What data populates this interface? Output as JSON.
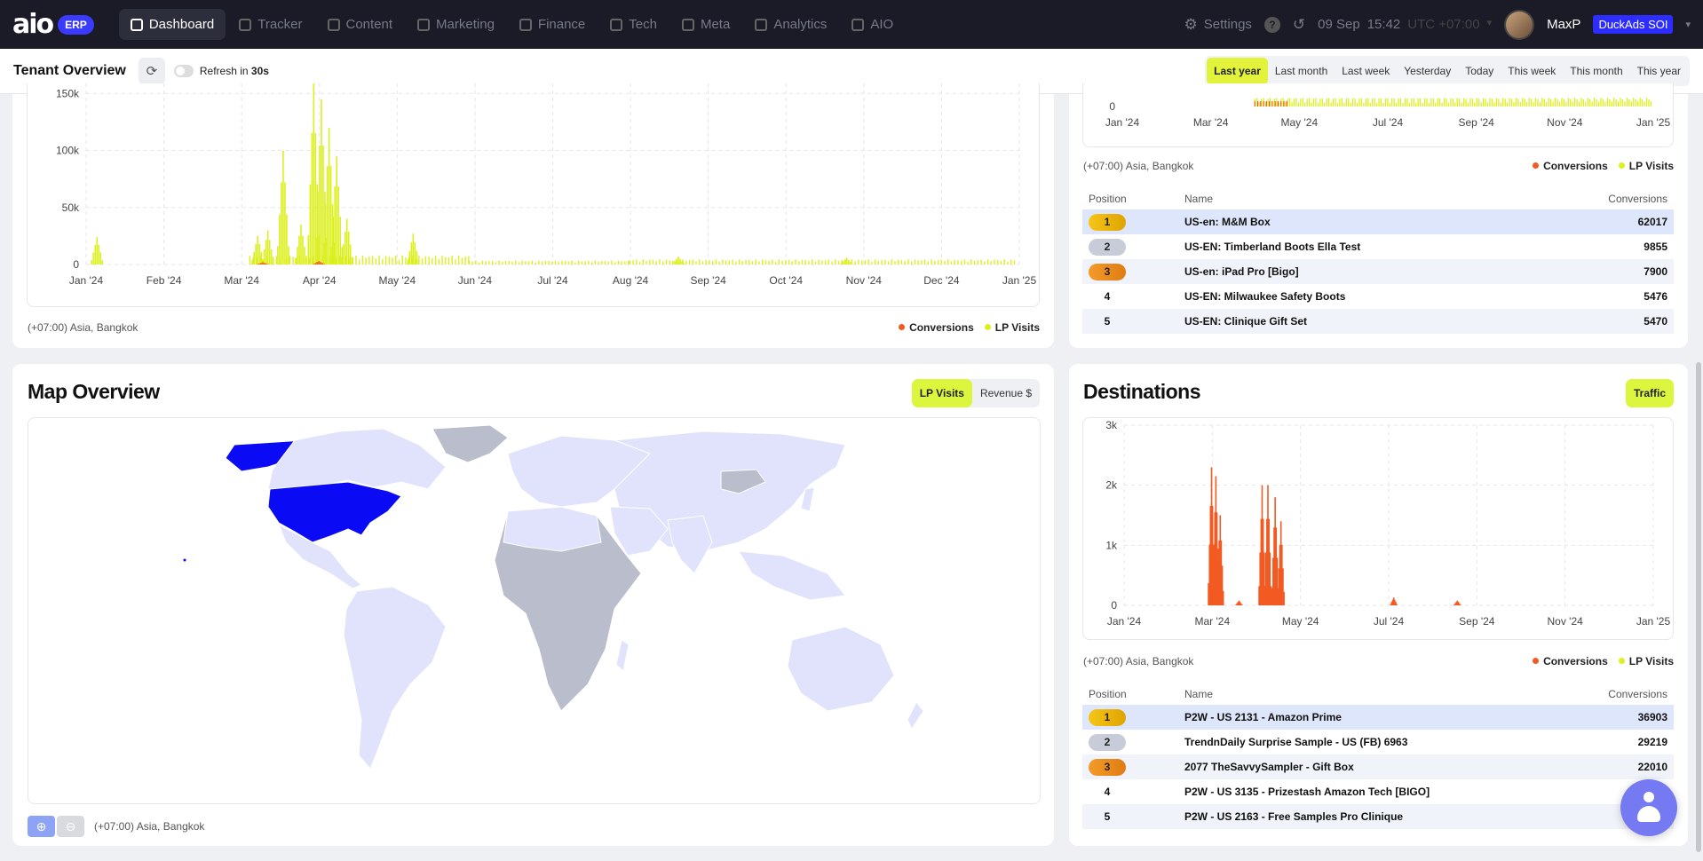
{
  "nav": {
    "logo": "aio",
    "logo_badge": "ERP",
    "items": [
      {
        "label": "Dashboard",
        "icon": "dashboard-icon",
        "active": true
      },
      {
        "label": "Tracker",
        "icon": "tracker-icon"
      },
      {
        "label": "Content",
        "icon": "content-icon"
      },
      {
        "label": "Marketing",
        "icon": "marketing-icon"
      },
      {
        "label": "Finance",
        "icon": "finance-icon"
      },
      {
        "label": "Tech",
        "icon": "tech-icon"
      },
      {
        "label": "Meta",
        "icon": "meta-icon"
      },
      {
        "label": "Analytics",
        "icon": "analytics-icon"
      },
      {
        "label": "AIO",
        "icon": "aio-icon"
      }
    ],
    "settings_label": "Settings",
    "date": "09 Sep",
    "time": "15:42",
    "timezone": "UTC +07:00",
    "user_name": "MaxP",
    "brand": "DuckAds SOI"
  },
  "header": {
    "title": "Tenant Overview",
    "refresh_prefix": "Refresh in",
    "refresh_value": "30s",
    "ranges": [
      "Last year",
      "Last month",
      "Last week",
      "Yesterday",
      "Today",
      "This week",
      "This month",
      "This year"
    ],
    "active_range": "Last year"
  },
  "legend": {
    "conversions": "Conversions",
    "lp_visits": "LP Visits"
  },
  "colors": {
    "conversions": "#f25a23",
    "lp_visits": "#dcef1f",
    "accent": "#dcf63e",
    "highlight": "#0000ff"
  },
  "timezone_label": "(+07:00)  Asia, Bangkok",
  "main_chart": {
    "chart_data": {
      "type": "bar",
      "x_ticks": [
        "Jan '24",
        "Feb '24",
        "Mar '24",
        "Apr '24",
        "May '24",
        "Jun '24",
        "Jul '24",
        "Aug '24",
        "Sep '24",
        "Oct '24",
        "Nov '24",
        "Dec '24",
        "Jan '25"
      ],
      "y_ticks": [
        "0",
        "50k",
        "100k",
        "150k"
      ],
      "ylim": [
        0,
        165000
      ],
      "grid": true,
      "series": [
        {
          "name": "LP Visits",
          "color": "#dcef1f",
          "peaks": [
            {
              "date": "2024-01-05",
              "value": 24000
            },
            {
              "date": "2024-03-08",
              "value": 25000
            },
            {
              "date": "2024-03-12",
              "value": 30000
            },
            {
              "date": "2024-03-18",
              "value": 100000
            },
            {
              "date": "2024-03-25",
              "value": 35000
            },
            {
              "date": "2024-03-30",
              "value": 160000
            },
            {
              "date": "2024-04-02",
              "value": 145000
            },
            {
              "date": "2024-04-05",
              "value": 120000
            },
            {
              "date": "2024-04-08",
              "value": 95000
            },
            {
              "date": "2024-04-12",
              "value": 40000
            },
            {
              "date": "2024-05-08",
              "value": 27000
            },
            {
              "date": "2024-08-20",
              "value": 7000
            },
            {
              "date": "2024-10-25",
              "value": 6000
            }
          ]
        },
        {
          "name": "Conversions",
          "color": "#f25a23",
          "peaks": [
            {
              "date": "2024-03-10",
              "value": 2000
            },
            {
              "date": "2024-04-01",
              "value": 3000
            }
          ]
        }
      ]
    }
  },
  "offers": {
    "chart_data": {
      "type": "bar",
      "x_ticks": [
        "Jan '24",
        "Mar '24",
        "May '24",
        "Jul '24",
        "Sep '24",
        "Nov '24",
        "Jan '25"
      ],
      "y_ticks": [
        "0"
      ]
    },
    "columns": [
      "Position",
      "Name",
      "Conversions"
    ],
    "rows": [
      {
        "pos": "1",
        "name": "US-en: M&M Box",
        "conv": "62017"
      },
      {
        "pos": "2",
        "name": "US-EN: Timberland Boots Ella Test",
        "conv": "9855"
      },
      {
        "pos": "3",
        "name": "US-en: iPad Pro [Bigo]",
        "conv": "7900"
      },
      {
        "pos": "4",
        "name": "US-EN: Milwaukee Safety Boots",
        "conv": "5476"
      },
      {
        "pos": "5",
        "name": "US-EN: Clinique Gift Set",
        "conv": "5470"
      }
    ]
  },
  "map": {
    "title": "Map Overview",
    "tabs": [
      "LP Visits",
      "Revenue $"
    ],
    "active_tab": "LP Visits"
  },
  "destinations": {
    "title": "Destinations",
    "tab": "Traffic",
    "chart_data": {
      "type": "bar",
      "x_ticks": [
        "Jan '24",
        "Mar '24",
        "May '24",
        "Jul '24",
        "Sep '24",
        "Nov '24",
        "Jan '25"
      ],
      "y_ticks": [
        "0",
        "1k",
        "2k",
        "3k"
      ],
      "ylim": [
        0,
        3000
      ],
      "grid": true,
      "series": [
        {
          "name": "Conversions",
          "color": "#f25a23",
          "peaks": [
            {
              "date": "2024-03-01",
              "value": 2300
            },
            {
              "date": "2024-03-04",
              "value": 2150
            },
            {
              "date": "2024-03-07",
              "value": 1500
            },
            {
              "date": "2024-03-20",
              "value": 80
            },
            {
              "date": "2024-04-05",
              "value": 2000
            },
            {
              "date": "2024-04-09",
              "value": 2000
            },
            {
              "date": "2024-04-14",
              "value": 1800
            },
            {
              "date": "2024-04-18",
              "value": 1400
            },
            {
              "date": "2024-07-05",
              "value": 130
            },
            {
              "date": "2024-08-18",
              "value": 80
            }
          ]
        }
      ]
    },
    "columns": [
      "Position",
      "Name",
      "Conversions"
    ],
    "rows": [
      {
        "pos": "1",
        "name": "P2W - US 2131 - Amazon Prime",
        "conv": "36903"
      },
      {
        "pos": "2",
        "name": "TrendnDaily Surprise Sample - US (FB) 6963",
        "conv": "29219"
      },
      {
        "pos": "3",
        "name": "2077 TheSavvySampler - Gift Box",
        "conv": "22010"
      },
      {
        "pos": "4",
        "name": "P2W - US 3135 - Prizestash Amazon Tech [BIGO]",
        "conv": "8304"
      },
      {
        "pos": "5",
        "name": "P2W - US 2163 - Free Samples Pro Clinique",
        "conv": "5239"
      }
    ]
  }
}
